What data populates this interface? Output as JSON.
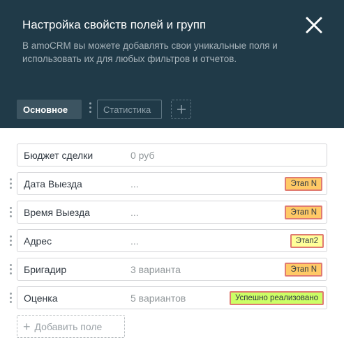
{
  "header": {
    "title": "Настройка свойств полей и групп",
    "subtitle": "В amoCRM вы можете добавлять свои уникальные поля и использовать их для любых фильтров и отчетов.",
    "close_icon": "close-icon"
  },
  "tabs": [
    {
      "label": "Основное",
      "active": true
    },
    {
      "label": "Статистика",
      "active": false
    }
  ],
  "fields": [
    {
      "name": "Бюджет сделки",
      "value": "0 руб",
      "badge": ""
    },
    {
      "name": "Дата Выезда",
      "value": "...",
      "badge": "Этап N",
      "badge_color": "#ffc966"
    },
    {
      "name": "Время Выезда",
      "value": "...",
      "badge": "Этап N",
      "badge_color": "#ffc966"
    },
    {
      "name": "Адрес",
      "value": "...",
      "badge": "Этап2",
      "badge_color": "#ffff99"
    },
    {
      "name": "Бригадир",
      "value": "3 варианта",
      "badge": "Этап N",
      "badge_color": "#ffc966"
    },
    {
      "name": "Оценка",
      "value": "5 вариантов",
      "badge": "Успешно реализовано",
      "badge_color": "#ccff66"
    }
  ],
  "add_field": {
    "plus": "+",
    "label": "Добавить поле"
  },
  "colors": {
    "header_bg": "#203a48",
    "active_tab_bg": "#3c5461",
    "badge_border": "#e07b71"
  }
}
